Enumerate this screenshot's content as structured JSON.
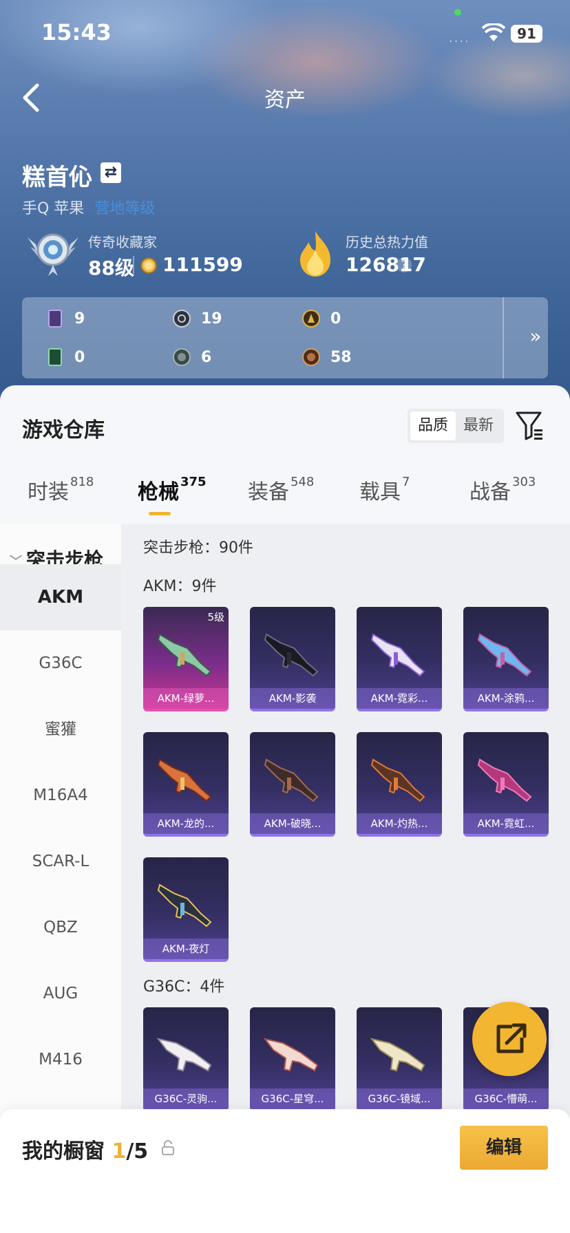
{
  "status_bar": {
    "time": "15:43",
    "battery": "91"
  },
  "header": {
    "title": "资产"
  },
  "profile": {
    "name": "糕首伈",
    "switch_icon": "swap-icon",
    "platform": "手Q 苹果",
    "platform_link": "营地等级"
  },
  "stats": {
    "collector_label": "传奇收藏家",
    "level": "88级",
    "score": "111599",
    "heat_label": "历史总热力值",
    "heat_value": "126817",
    "help": "?"
  },
  "counts": {
    "items": [
      {
        "icon": "purple-card-icon",
        "value": "9"
      },
      {
        "icon": "silver-coin-icon",
        "value": "19"
      },
      {
        "icon": "gold-coin-icon",
        "value": "0"
      },
      {
        "icon": "green-card-icon",
        "value": "0"
      },
      {
        "icon": "grey-medal-icon",
        "value": "6"
      },
      {
        "icon": "bronze-medal-icon",
        "value": "58"
      }
    ],
    "more": "»"
  },
  "warehouse": {
    "title": "游戏仓库",
    "sort_quality": "品质",
    "sort_newest": "最新",
    "tabs": [
      {
        "label": "时装",
        "count": "818"
      },
      {
        "label": "枪械",
        "count": "375"
      },
      {
        "label": "装备",
        "count": "548"
      },
      {
        "label": "载具",
        "count": "7"
      },
      {
        "label": "战备",
        "count": "303"
      }
    ]
  },
  "nav": {
    "group": "突击步枪",
    "items": [
      "AKM",
      "G36C",
      "蜜獾",
      "M16A4",
      "SCAR-L",
      "QBZ",
      "AUG",
      "M416"
    ]
  },
  "grid": {
    "total_label": "突击步枪：90件",
    "akm_label": "AKM：9件",
    "g36c_label": "G36C：4件",
    "akm_cards": [
      {
        "name": "AKM-绿萝...",
        "level": "5级"
      },
      {
        "name": "AKM-影袭"
      },
      {
        "name": "AKM-霓彩..."
      },
      {
        "name": "AKM-涂鸦..."
      },
      {
        "name": "AKM-龙的..."
      },
      {
        "name": "AKM-破晓..."
      },
      {
        "name": "AKM-灼热..."
      },
      {
        "name": "AKM-霓虹..."
      },
      {
        "name": "AKM-夜灯"
      }
    ],
    "g36c_cards": [
      {
        "name": "G36C-灵驹..."
      },
      {
        "name": "G36C-星穹..."
      },
      {
        "name": "G36C-镜域..."
      },
      {
        "name": "G36C-懵萌..."
      }
    ]
  },
  "showcase": {
    "title": "我的橱窗",
    "current": "1",
    "total": "/5",
    "edit_label": "编辑"
  },
  "colors": {
    "accent": "#f0b432",
    "card_purple": "#342f62",
    "card_pink": "#c9378f"
  }
}
